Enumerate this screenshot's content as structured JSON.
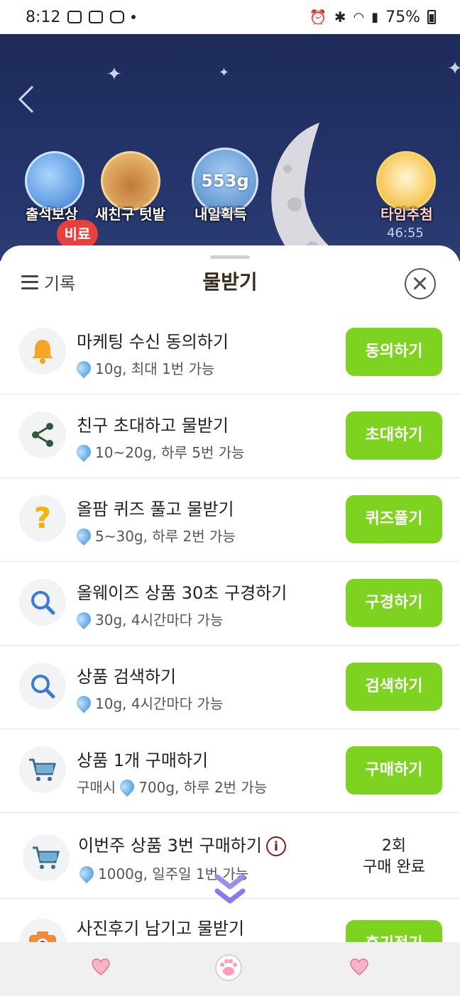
{
  "status_bar": {
    "time": "8:12",
    "battery": "75%"
  },
  "banner": {
    "games": [
      {
        "label": "출석보상"
      },
      {
        "label": "새친구 텃밭"
      },
      {
        "label": "내일획득",
        "amount": "553g"
      },
      {
        "label": "타임추첨",
        "timer": "46:55"
      }
    ],
    "badge": "비료"
  },
  "sheet": {
    "history_label": "기록",
    "title": "물받기"
  },
  "tasks": [
    {
      "title": "마케팅 수신 동의하기",
      "reward": "10g, 최대 1번 가능",
      "button": "동의하기",
      "icon": "bell-icon"
    },
    {
      "title": "친구 초대하고 물받기",
      "reward": "10~20g, 하루 5번 가능",
      "button": "초대하기",
      "icon": "share-icon"
    },
    {
      "title": "올팜 퀴즈 풀고 물받기",
      "reward": "5~30g, 하루 2번 가능",
      "button": "퀴즈풀기",
      "icon": "question-icon"
    },
    {
      "title": "올웨이즈 상품 30초 구경하기",
      "reward": "30g, 4시간마다 가능",
      "button": "구경하기",
      "icon": "search-icon"
    },
    {
      "title": "상품 검색하기",
      "reward": "10g, 4시간마다 가능",
      "button": "검색하기",
      "icon": "search-icon"
    },
    {
      "title": "상품 1개 구매하기",
      "prefix": "구매시",
      "reward": "700g, 하루 2번 가능",
      "button": "구매하기",
      "icon": "cart-icon"
    },
    {
      "title": "이번주 상품 3번 구매하기",
      "reward": "1000g, 일주일 1번 가능",
      "status_line1": "2회",
      "status_line2": "구매 완료",
      "icon": "cart-icon"
    },
    {
      "title": "사진후기 남기고 물받기",
      "button": "후기적기",
      "icon": "camera-icon"
    }
  ],
  "colors": {
    "accent_green": "#7ed321",
    "banner_bg": "#24346a"
  }
}
